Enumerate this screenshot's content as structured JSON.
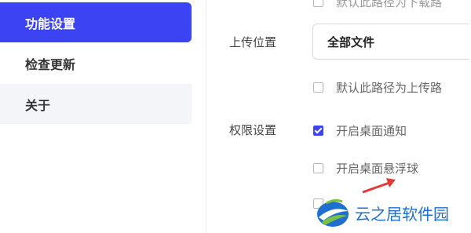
{
  "sidebar": {
    "items": [
      {
        "label": "功能设置"
      },
      {
        "label": "检查更新"
      },
      {
        "label": "关于"
      }
    ]
  },
  "settings": {
    "top_partial_option": "默认此路径为下载路",
    "upload_location": {
      "label": "上传位置",
      "selected": "全部文件",
      "default_option": "默认此路径为上传路"
    },
    "permissions": {
      "label": "权限设置",
      "desktop_notification": "开启桌面通知",
      "desktop_notification_checked": true,
      "floating_ball": "开启桌面悬浮球",
      "floating_ball_checked": false
    }
  },
  "watermark": {
    "text": "云之居软件园"
  },
  "colors": {
    "accent": "#3b43f2",
    "arrow": "#e53935",
    "watermark": "#1e6fd0"
  }
}
